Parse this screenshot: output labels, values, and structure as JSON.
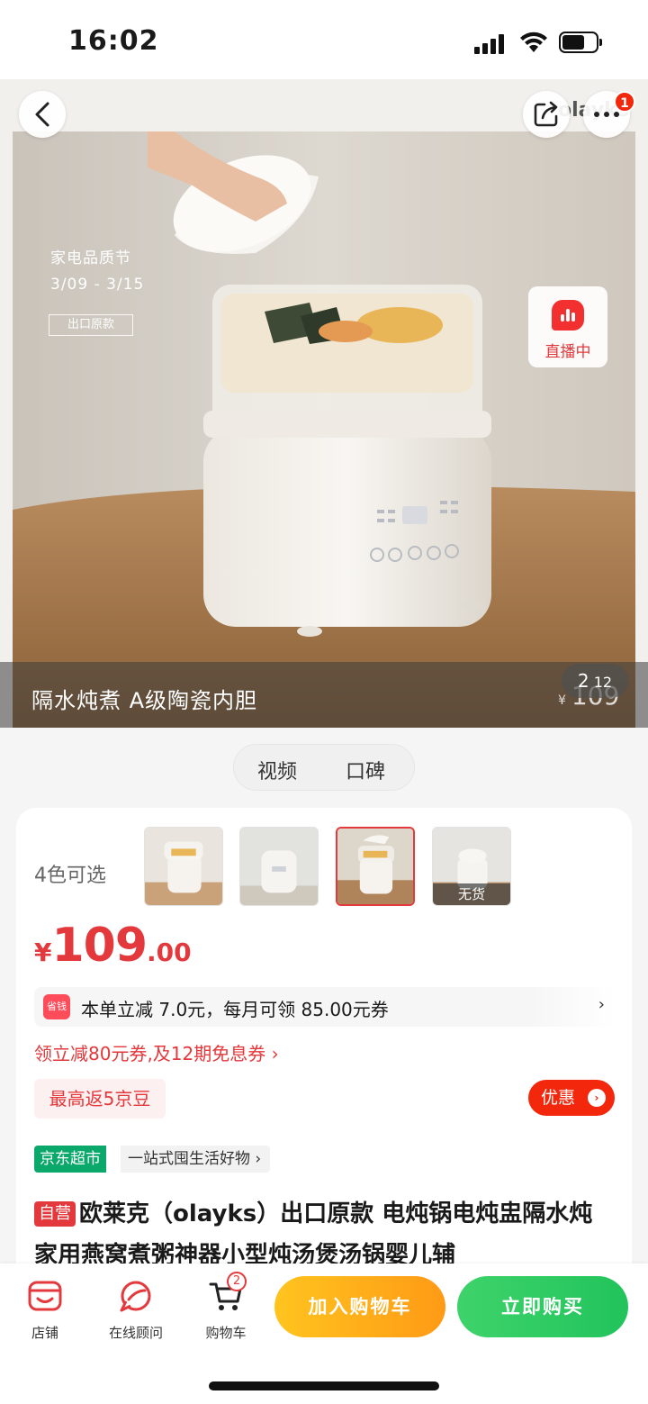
{
  "status_bar": {
    "time": "16:02"
  },
  "hero": {
    "caption": "隔水炖煮 A级陶瓷内胆",
    "price_ghost": "109",
    "price_ghost_currency": "¥",
    "page_current": "2",
    "page_total": "12",
    "promo_line1": "家电品质节",
    "promo_line2": "3/09 - 3/15",
    "promo_tag": "出口原款",
    "brand_peek": "olayks",
    "notif_count": "1",
    "live_label": "直播中"
  },
  "media_tabs": [
    "视频",
    "口碑"
  ],
  "variants": {
    "count_label": "4色可选",
    "out_of_stock_label": "无货",
    "selected_index": 2
  },
  "price": {
    "currency": "¥",
    "integer": "109",
    "decimal": ".00"
  },
  "coupon": {
    "icon_text": "省钱",
    "text": "本单立减 7.0元，每月可领 85.00元券",
    "arrow": "›"
  },
  "promo_link": "领立减80元券,及12期免息券 ›",
  "bean_tag": "最高返5京豆",
  "youhui_label": "优惠",
  "youhui_arrow": "›",
  "channel": {
    "tag": "京东超市",
    "sub": "一站式囤生活好物 ›"
  },
  "product": {
    "self_tag": "自营",
    "title": "欧莱克（olayks）出口原款 电炖锅电炖盅隔水炖家用燕窝煮粥神器小型炖汤煲汤锅婴儿辅"
  },
  "bottom_bar": {
    "shop": "店铺",
    "advisor": "在线顾问",
    "cart": "购物车",
    "cart_count": "2",
    "add_to_cart": "加入购物车",
    "buy_now": "立即购买"
  },
  "colors": {
    "jd_red": "#e4393c",
    "cart_orange": "#ffa41a",
    "buy_green": "#2ccb63",
    "supermarket_green": "#0aa86a"
  }
}
